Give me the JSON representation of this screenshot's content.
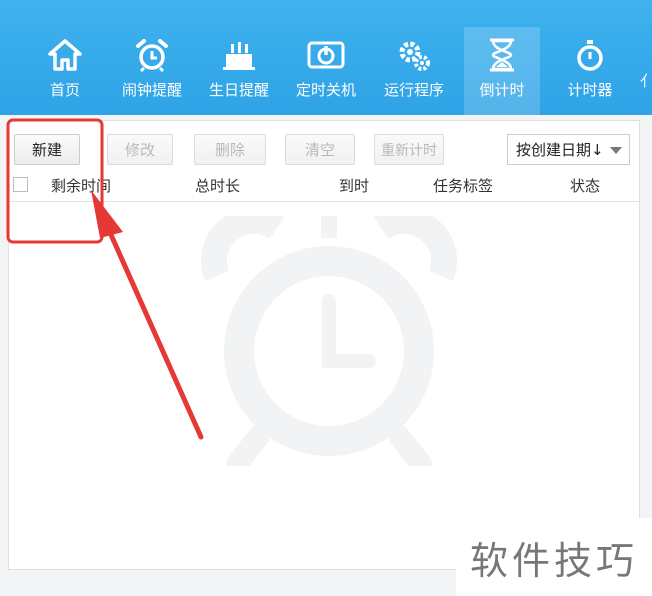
{
  "toolbar": {
    "items": [
      {
        "label": "首页",
        "icon": "home-icon"
      },
      {
        "label": "闹钟提醒",
        "icon": "alarm-clock-icon"
      },
      {
        "label": "生日提醒",
        "icon": "birthday-cake-icon"
      },
      {
        "label": "定时关机",
        "icon": "power-icon"
      },
      {
        "label": "运行程序",
        "icon": "gears-icon"
      },
      {
        "label": "倒计时",
        "icon": "hourglass-icon",
        "active": true
      },
      {
        "label": "计时器",
        "icon": "stopwatch-icon"
      }
    ],
    "colors": {
      "bar": "#2ea3e6",
      "text": "#ffffff"
    }
  },
  "actions": {
    "new": "新建",
    "edit": "修改",
    "delete": "删除",
    "clear": "清空",
    "restart": "重新计时"
  },
  "sort": {
    "selected": "按创建日期↓"
  },
  "table": {
    "columns": [
      "剩余时间",
      "总时长",
      "到时",
      "任务标签",
      "状态"
    ],
    "rows": []
  },
  "watermark": {
    "text": "软件技巧"
  },
  "annotation": {
    "color": "#e53935"
  }
}
